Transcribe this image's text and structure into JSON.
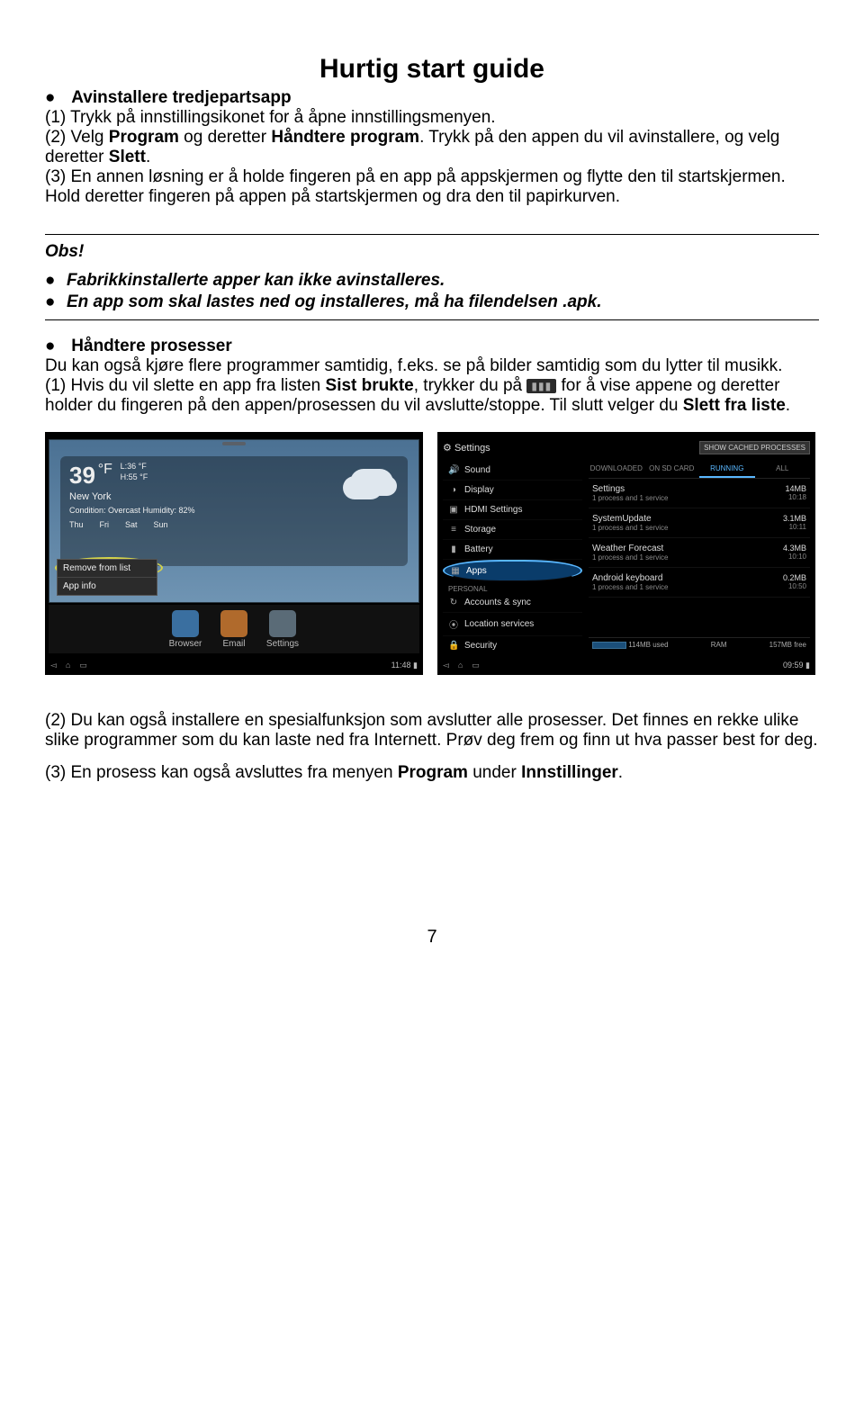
{
  "title": "Hurtig start guide",
  "sec_uninstall": {
    "heading": "Avinstallere tredjepartsapp",
    "p1a": "(1) Trykk på innstillingsikonet for å åpne innstillingsmenyen.",
    "p2a": "(2) Velg ",
    "p2b": "Program",
    "p2c": " og deretter ",
    "p2d": "Håndtere program",
    "p2e": ". Trykk på den appen du vil avinstallere, og velg deretter ",
    "p2f": "Slett",
    "p2g": ".",
    "p3": "(3) En annen løsning er å holde fingeren på en app på appskjermen og flytte den til startskjermen. Hold deretter fingeren på appen på startskjermen og dra den til papirkurven."
  },
  "obs": {
    "title": "Obs!",
    "b1": "Fabrikkinstallerte apper kan ikke avinstalleres.",
    "b2": "En app som skal lastes ned og installeres, må ha filendelsen .apk."
  },
  "sec_process": {
    "heading": "Håndtere prosesser",
    "p_intro": "Du kan også kjøre flere programmer samtidig, f.eks. se på bilder samtidig som du lytter til musikk.",
    "p1a": "(1) Hvis du vil slette en app fra listen ",
    "p1b": "Sist brukte",
    "p1c": ", trykker du på ",
    "p1d": "for å vise appene og deretter holder du fingeren på den appen/prosessen du vil avslutte/stoppe. Til slutt velger du ",
    "p1e": "Slett fra liste",
    "p1f": ".",
    "p2": "(2) Du kan også installere en spesialfunksjon som avslutter alle prosesser. Det finnes en rekke ulike slike programmer som du kan laste ned fra Internett. Prøv deg frem og finn ut hva passer best for deg.",
    "p3a": "(3) En prosess kan også avsluttes fra menyen ",
    "p3b": "Program",
    "p3c": " under ",
    "p3d": "Innstillinger",
    "p3e": "."
  },
  "fig1": {
    "temp": "39",
    "unit": "°F",
    "hi": "L:36 °F",
    "lo": "H:55 °F",
    "city": "New York",
    "cond": "Condition: Overcast Humidity: 82%",
    "days": [
      "Thu",
      "Fri",
      "Sat",
      "Sun"
    ],
    "popup1": "Remove from list",
    "popup2": "App info",
    "dock": [
      {
        "label": "Browser",
        "c": "#3a6fa0"
      },
      {
        "label": "Email",
        "c": "#b06a2c"
      },
      {
        "label": "Settings",
        "c": "#5a6b77"
      }
    ],
    "clock": "11:48"
  },
  "fig2": {
    "topleft_icon": "⚙",
    "topleft": "Settings",
    "topright": "SHOW CACHED PROCESSES",
    "side": [
      {
        "icon": "🔊",
        "label": "Sound"
      },
      {
        "icon": "◑",
        "label": "Display"
      },
      {
        "icon": "▣",
        "label": "HDMI Settings"
      },
      {
        "icon": "≡",
        "label": "Storage"
      },
      {
        "icon": "▮",
        "label": "Battery"
      },
      {
        "icon": "▦",
        "label": "Apps",
        "hi": true
      }
    ],
    "side_section": "PERSONAL",
    "side2": [
      {
        "icon": "↻",
        "label": "Accounts & sync"
      },
      {
        "icon": "⦿",
        "label": "Location services"
      },
      {
        "icon": "🔒",
        "label": "Security"
      }
    ],
    "tabs": [
      "DOWNLOADED",
      "ON SD CARD",
      "RUNNING",
      "ALL"
    ],
    "active_tab": 2,
    "list": [
      {
        "t": "Settings",
        "s": "1 process and 1 service",
        "m": "14MB",
        "d": "10:18"
      },
      {
        "t": "SystemUpdate",
        "s": "1 process and 1 service",
        "m": "3.1MB",
        "d": "10:11"
      },
      {
        "t": "Weather Forecast",
        "s": "1 process and 1 service",
        "m": "4.3MB",
        "d": "10:10"
      },
      {
        "t": "Android keyboard",
        "s": "1 process and 1 service",
        "m": "0.2MB",
        "d": "10:50"
      }
    ],
    "foot_used": "114MB used",
    "foot_ram": "RAM",
    "foot_free": "157MB free",
    "clock": "09:59"
  },
  "page_number": "7"
}
